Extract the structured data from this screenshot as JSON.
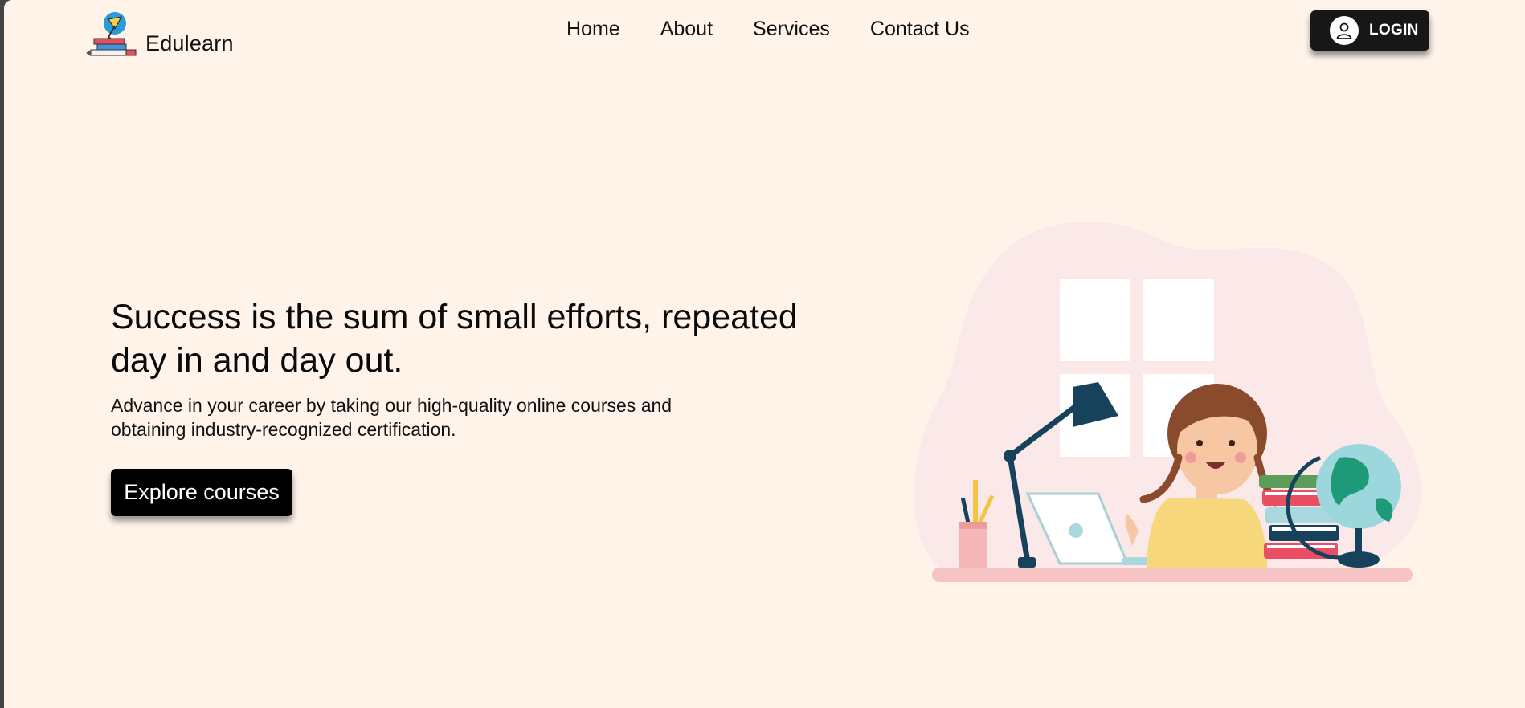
{
  "brand": {
    "name": "Edulearn"
  },
  "nav": {
    "items": [
      "Home",
      "About",
      "Services",
      "Contact Us"
    ]
  },
  "header": {
    "login_label": "LOGIN"
  },
  "hero": {
    "title": "Success is the sum of small efforts, repeated day in and day out.",
    "subtitle": "Advance in your career by taking our high-quality online courses and obtaining industry-recognized certification.",
    "cta_label": "Explore courses"
  },
  "colors": {
    "page_bg": "#fff3ea",
    "button_bg": "#000000",
    "blob": "#fbe9ea",
    "desk": "#f7c4c4",
    "lamp": "#16425b"
  },
  "icons": [
    "logo-icon",
    "user-icon",
    "study-illustration"
  ]
}
